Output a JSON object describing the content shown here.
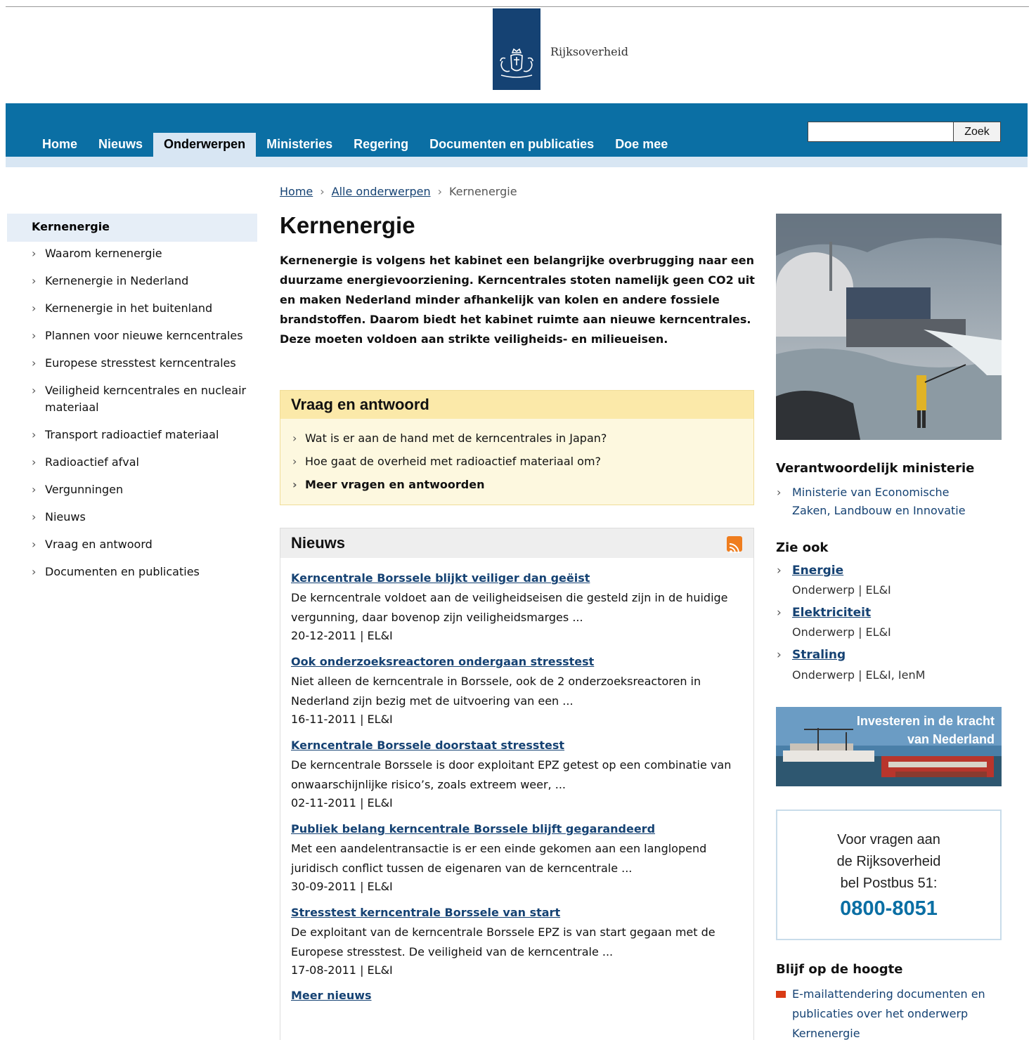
{
  "header": {
    "logo_text": "Rijksoverheid",
    "logo_color": "#154273"
  },
  "nav": {
    "items": [
      {
        "label": "Home"
      },
      {
        "label": "Nieuws"
      },
      {
        "label": "Onderwerpen",
        "active": true
      },
      {
        "label": "Ministeries"
      },
      {
        "label": "Regering"
      },
      {
        "label": "Documenten en publicaties"
      },
      {
        "label": "Doe mee"
      }
    ],
    "search_value": "",
    "search_button": "Zoek",
    "bar_color": "#0b6fa4"
  },
  "breadcrumb": {
    "home": "Home",
    "all": "Alle onderwerpen",
    "current": "Kernenergie"
  },
  "sidebar": {
    "title": "Kernenergie",
    "items": [
      {
        "label": "Waarom kernenergie"
      },
      {
        "label": "Kernenergie in Nederland"
      },
      {
        "label": "Kernenergie in het buitenland"
      },
      {
        "label": "Plannen voor nieuwe kerncentrales"
      },
      {
        "label": "Europese stresstest kerncentrales"
      },
      {
        "label": "Veiligheid kerncentrales en nucleair materiaal"
      },
      {
        "label": "Transport radioactief materiaal"
      },
      {
        "label": "Radioactief afval"
      },
      {
        "label": "Vergunningen"
      },
      {
        "label": "Nieuws"
      },
      {
        "label": "Vraag en antwoord"
      },
      {
        "label": "Documenten en publicaties"
      }
    ]
  },
  "main": {
    "title": "Kernenergie",
    "intro": "Kernenergie is volgens het kabinet een belangrijke overbrugging naar een duurzame energievoorziening. Kerncentrales stoten namelijk geen CO2 uit en maken Nederland minder afhankelijk van kolen en andere fossiele brandstoffen. Daarom biedt het kabinet ruimte aan nieuwe kerncentrales. Deze moeten voldoen aan strikte veiligheids- en milieueisen.",
    "qa": {
      "title": "Vraag en antwoord",
      "items": [
        {
          "label": "Wat is er aan de hand met de kerncentrales in Japan?"
        },
        {
          "label": "Hoe gaat de overheid met radioactief materiaal om?"
        }
      ],
      "more": "Meer vragen en antwoorden"
    },
    "news": {
      "title": "Nieuws",
      "items": [
        {
          "title": "Kerncentrale Borssele blijkt veiliger dan geëist",
          "text": "De kerncentrale voldoet aan de veiligheidseisen die gesteld zijn in de huidige vergunning, daar bovenop zijn veiligheidsmarges ...",
          "meta": "20-12-2011 | EL&I"
        },
        {
          "title": "Ook onderzoeksreactoren ondergaan stresstest",
          "text": "Niet alleen de kerncentrale in Borssele, ook de 2 onderzoeksreactoren in Nederland zijn bezig met de uitvoering van een ...",
          "meta": "16-11-2011 | EL&I"
        },
        {
          "title": "Kerncentrale Borssele doorstaat stresstest",
          "text": "De kerncentrale Borssele is door exploitant EPZ getest op een combinatie van onwaarschijnlijke risico’s, zoals extreem weer, ...",
          "meta": "02-11-2011 | EL&I"
        },
        {
          "title": "Publiek belang kerncentrale Borssele blijft gegarandeerd",
          "text": "Met een aandelentransactie is er een einde gekomen aan een langlopend juridisch conflict tussen de eigenaren van de kerncentrale ...",
          "meta": "30-09-2011 | EL&I"
        },
        {
          "title": "Stresstest kerncentrale Borssele van start",
          "text": "De exploitant van de kerncentrale Borssele EPZ is van start gegaan met de Europese stresstest. De veiligheid van de kerncentrale ...",
          "meta": "17-08-2011 | EL&I"
        }
      ],
      "more": "Meer nieuws"
    }
  },
  "right": {
    "ministry_title": "Verantwoordelijk ministerie",
    "ministry_link": "Ministerie van Economische Zaken, Landbouw en Innovatie",
    "see_also_title": "Zie ook",
    "see_also": [
      {
        "title": "Energie",
        "sub": "Onderwerp | EL&I"
      },
      {
        "title": "Elektriciteit",
        "sub": "Onderwerp | EL&I"
      },
      {
        "title": "Straling",
        "sub": "Onderwerp | EL&I, IenM"
      }
    ],
    "banner_text": "Investeren in de kracht van Nederland",
    "postbus": {
      "line1": "Voor vragen aan",
      "line2": "de Rijksoverheid",
      "line3": "bel Postbus 51:",
      "phone": "0800-8051"
    },
    "stay_title": "Blijf op de hoogte",
    "stay_link": "E-mailattendering documenten en publicaties over het onderwerp Kernenergie"
  }
}
